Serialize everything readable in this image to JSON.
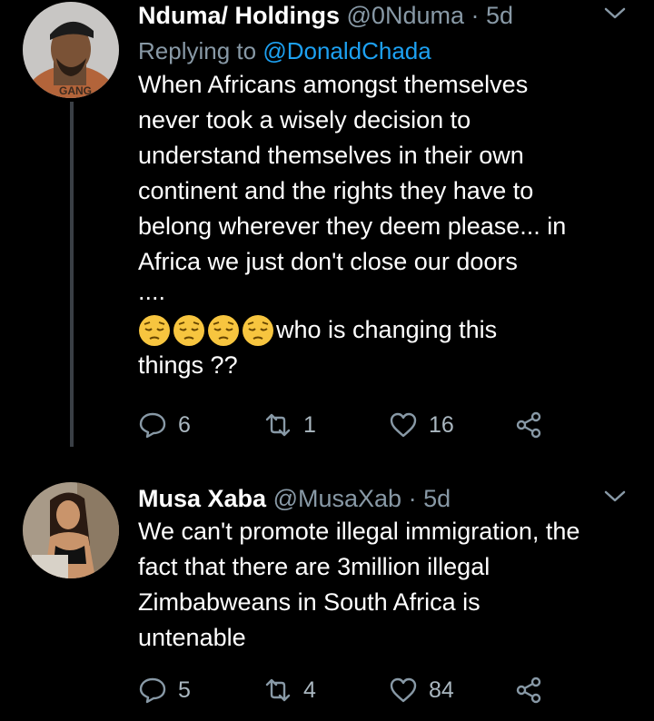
{
  "tweets": [
    {
      "name": "Nduma/ Holdings",
      "handle": "@0Nduma",
      "separator": "·",
      "time": "5d",
      "reply_prefix": "Replying to",
      "reply_to": "@DonaldChada",
      "text_lines": [
        "When Africans amongst themselves",
        "never took a wisely decision to",
        "understand themselves in their own",
        "continent and the rights they have to",
        "belong wherever they deem please... in",
        "Africa we  just don't close our doors",
        "...."
      ],
      "emoji_text": "who is changing this",
      "text_last": "things ??",
      "emoji_icon": "pensive-face-icon",
      "replies": "6",
      "retweets": "1",
      "likes": "16"
    },
    {
      "name": "Musa Xaba",
      "handle": "@MusaXab",
      "separator": "·",
      "time": "5d",
      "text_lines": [
        "We can't promote illegal immigration, the",
        "fact that there are 3million illegal",
        "Zimbabweans in South Africa is",
        "untenable"
      ],
      "replies": "5",
      "retweets": "4",
      "likes": "84"
    }
  ],
  "colors": {
    "background": "#000000",
    "muted": "#8899a6",
    "link": "#1da1f2",
    "emoji": "#f7c53f"
  }
}
